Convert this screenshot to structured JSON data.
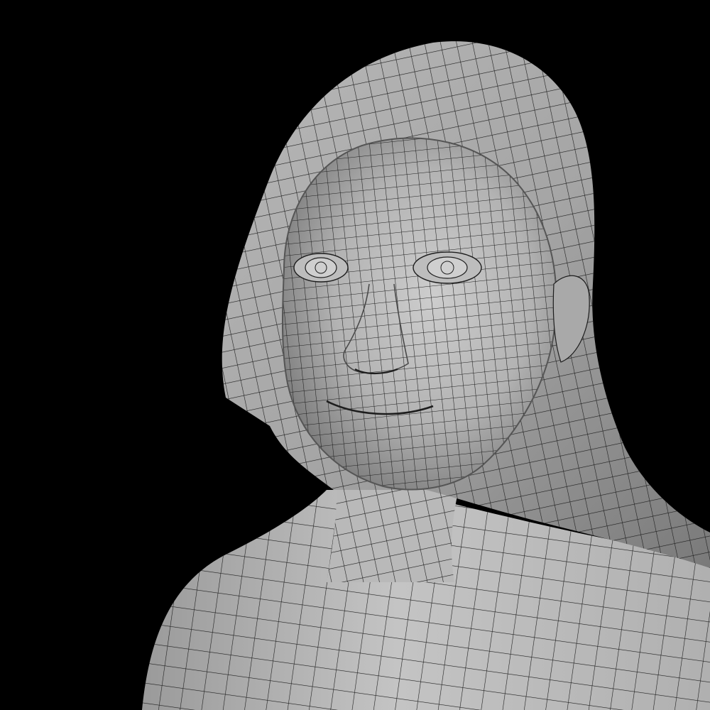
{
  "scene": {
    "subject": "head-and-shoulders-mesh",
    "render_style": "clay-wireframe-overlay",
    "colors": {
      "background": "#000000",
      "surface_light": "#c9c9c9",
      "surface_mid": "#a9a9a9",
      "surface_dark": "#6a6a6a",
      "wire": "#1d1d1d"
    }
  }
}
